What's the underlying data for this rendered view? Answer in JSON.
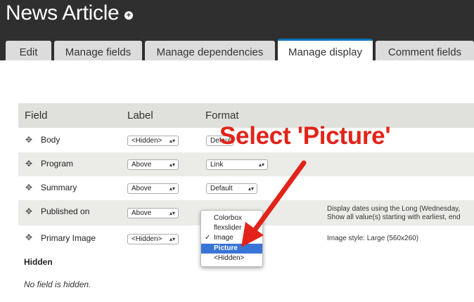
{
  "page_title": "News Article",
  "tabs": [
    "Edit",
    "Manage fields",
    "Manage dependencies",
    "Manage display",
    "Comment fields"
  ],
  "columns": {
    "field": "Field",
    "label": "Label",
    "format": "Format"
  },
  "rows": [
    {
      "field": "Body",
      "label": "<Hidden>",
      "format": "Default"
    },
    {
      "field": "Program",
      "label": "Above",
      "format": "Link"
    },
    {
      "field": "Summary",
      "label": "Above",
      "format": "Default"
    },
    {
      "field": "Published on",
      "label": "Above",
      "format": "",
      "note_line1": "Display dates using the Long (Wednesday,",
      "note_line2": "Show all value(s) starting with earliest, end"
    },
    {
      "field": "Primary Image",
      "label": "<Hidden>",
      "format": "",
      "note_line1": "Image style: Large (560x260)"
    }
  ],
  "dropdown": {
    "options": [
      "Colorbox",
      "flexslider",
      "Image",
      "Picture",
      "<Hidden>"
    ],
    "checked": "Image",
    "highlighted": "Picture"
  },
  "hidden_section": {
    "heading": "Hidden",
    "empty_text": "No field is hidden."
  },
  "annotation": {
    "text": "Select 'Picture'",
    "color": "#e2231a"
  },
  "colors": {
    "header_bg": "#2f2f2f",
    "active_tab_accent": "#0c73b8",
    "menu_highlight": "#3875d7"
  }
}
